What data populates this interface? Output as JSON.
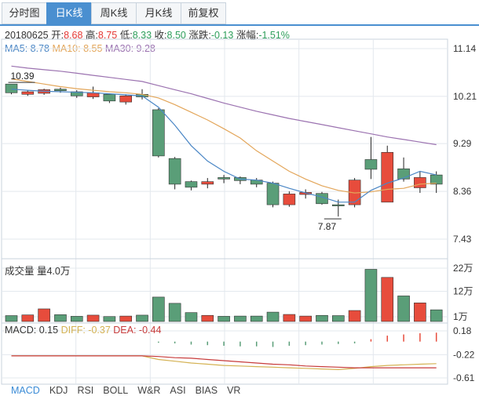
{
  "tabs": [
    {
      "label": "分时图",
      "active": false
    },
    {
      "label": "日K线",
      "active": true
    },
    {
      "label": "周K线",
      "active": false
    },
    {
      "label": "月K线",
      "active": false
    },
    {
      "label": "前复权",
      "active": false
    }
  ],
  "quote": {
    "date": "20180625",
    "open_label": "开:",
    "open": "8.68",
    "high_label": "高:",
    "high": "8.75",
    "low_label": "低:",
    "low": "8.33",
    "close_label": "收:",
    "close": "8.50",
    "change_label": "涨跌:",
    "change": "-0.13",
    "pct_label": "涨幅:",
    "pct": "-1.51%"
  },
  "ma_legend": {
    "ma5_label": "MA5: ",
    "ma5": "8.78",
    "ma10_label": "MA10: ",
    "ma10": "8.55",
    "ma30_label": "MA30: ",
    "ma30": "9.28"
  },
  "volume_legend": "成交量 量4.0万",
  "macd_legend": {
    "macd": "MACD: 0.15",
    "diff": "DIFF: -0.37",
    "dea": "DEA: -0.44"
  },
  "indicator_tabs": [
    {
      "label": "MACD",
      "active": true
    },
    {
      "label": "KDJ",
      "active": false
    },
    {
      "label": "RSI",
      "active": false
    },
    {
      "label": "BOLL",
      "active": false
    },
    {
      "label": "W&R",
      "active": false
    },
    {
      "label": "ASI",
      "active": false
    },
    {
      "label": "BIAS",
      "active": false
    },
    {
      "label": "VR",
      "active": false
    }
  ],
  "colors": {
    "up": "#e74c3c",
    "down": "#5a9e78",
    "ma5": "#4a86c5",
    "ma10": "#e3a65a",
    "ma30": "#9b72b0",
    "diff": "#d4b253",
    "dea": "#c73b3b",
    "grid": "#e3e8ee"
  },
  "chart_data": {
    "type": "candlestick",
    "price_axis": {
      "ticks": [
        "11.14",
        "10.21",
        "9.29",
        "8.36",
        "7.43"
      ],
      "ylim": [
        7.43,
        11.14
      ]
    },
    "volume_axis": {
      "ticks": [
        "22万",
        "12万",
        "1万"
      ],
      "ylim": [
        1,
        22
      ]
    },
    "macd_axis": {
      "ticks": [
        "0.18",
        "-0.22",
        "-0.61"
      ],
      "ylim": [
        -0.61,
        0.18
      ]
    },
    "annotations": [
      {
        "text": "10.39",
        "kind": "high"
      },
      {
        "text": "7.87",
        "kind": "low"
      }
    ],
    "candles": [
      {
        "open": 10.45,
        "close": 10.28,
        "high": 10.39,
        "low": 10.25,
        "volume": 1.5
      },
      {
        "open": 10.25,
        "close": 10.3,
        "high": 10.33,
        "low": 10.22,
        "volume": 1.8
      },
      {
        "open": 10.27,
        "close": 10.34,
        "high": 10.36,
        "low": 10.24,
        "volume": 4.4
      },
      {
        "open": 10.35,
        "close": 10.32,
        "high": 10.38,
        "low": 10.28,
        "volume": 1.9
      },
      {
        "open": 10.3,
        "close": 10.22,
        "high": 10.33,
        "low": 10.18,
        "volume": 1.2
      },
      {
        "open": 10.2,
        "close": 10.28,
        "high": 10.4,
        "low": 10.16,
        "volume": 1.7
      },
      {
        "open": 10.25,
        "close": 10.12,
        "high": 10.27,
        "low": 10.08,
        "volume": 1.1
      },
      {
        "open": 10.1,
        "close": 10.22,
        "high": 10.25,
        "low": 10.05,
        "volume": 1.3
      },
      {
        "open": 10.25,
        "close": 10.2,
        "high": 10.35,
        "low": 10.15,
        "volume": 1.7
      },
      {
        "open": 9.95,
        "close": 9.05,
        "high": 9.98,
        "low": 9.02,
        "volume": 9.5
      },
      {
        "open": 9.0,
        "close": 8.5,
        "high": 9.03,
        "low": 8.4,
        "volume": 6.8
      },
      {
        "open": 8.55,
        "close": 8.44,
        "high": 8.57,
        "low": 8.38,
        "volume": 2.8
      },
      {
        "open": 8.5,
        "close": 8.55,
        "high": 8.62,
        "low": 8.42,
        "volume": 1.6
      },
      {
        "open": 8.63,
        "close": 8.6,
        "high": 8.68,
        "low": 8.52,
        "volume": 1.2
      },
      {
        "open": 8.63,
        "close": 8.57,
        "high": 8.65,
        "low": 8.5,
        "volume": 1.3
      },
      {
        "open": 8.58,
        "close": 8.5,
        "high": 8.62,
        "low": 8.44,
        "volume": 1.3
      },
      {
        "open": 8.52,
        "close": 8.1,
        "high": 8.55,
        "low": 8.05,
        "volume": 3.0
      },
      {
        "open": 8.1,
        "close": 8.31,
        "high": 8.36,
        "low": 8.06,
        "volume": 2.0
      },
      {
        "open": 8.3,
        "close": 8.34,
        "high": 8.4,
        "low": 8.22,
        "volume": 1.3
      },
      {
        "open": 8.32,
        "close": 8.12,
        "high": 8.35,
        "low": 8.1,
        "volume": 1.6
      },
      {
        "open": 8.1,
        "close": 8.08,
        "high": 8.2,
        "low": 7.87,
        "volume": 1.5
      },
      {
        "open": 8.1,
        "close": 8.58,
        "high": 8.62,
        "low": 8.05,
        "volume": 3.7
      },
      {
        "open": 8.98,
        "close": 8.79,
        "high": 9.42,
        "low": 8.6,
        "volume": 21.5
      },
      {
        "open": 8.15,
        "close": 9.12,
        "high": 9.25,
        "low": 8.15,
        "volume": 18.0
      },
      {
        "open": 8.8,
        "close": 8.6,
        "high": 9.02,
        "low": 8.55,
        "volume": 10.0
      },
      {
        "open": 8.43,
        "close": 8.63,
        "high": 8.75,
        "low": 8.33,
        "volume": 7.0
      },
      {
        "open": 8.68,
        "close": 8.5,
        "high": 8.75,
        "low": 8.33,
        "volume": 4.0
      }
    ],
    "ma5": [
      10.35,
      10.33,
      10.31,
      10.3,
      10.29,
      10.28,
      10.26,
      10.24,
      10.22,
      10.0,
      9.65,
      9.25,
      8.95,
      8.75,
      8.6,
      8.58,
      8.52,
      8.42,
      8.33,
      8.25,
      8.15,
      8.15,
      8.38,
      8.52,
      8.62,
      8.75,
      8.68
    ],
    "ma10": [
      10.55,
      10.5,
      10.45,
      10.4,
      10.36,
      10.33,
      10.3,
      10.28,
      10.25,
      10.18,
      10.05,
      9.9,
      9.75,
      9.58,
      9.4,
      9.15,
      8.95,
      8.75,
      8.6,
      8.47,
      8.38,
      8.33,
      8.35,
      8.4,
      8.42,
      8.5,
      8.52
    ],
    "ma30": [
      10.8,
      10.76,
      10.73,
      10.7,
      10.66,
      10.62,
      10.58,
      10.54,
      10.5,
      10.42,
      10.34,
      10.26,
      10.17,
      10.08,
      10.0,
      9.92,
      9.85,
      9.78,
      9.72,
      9.66,
      9.6,
      9.54,
      9.48,
      9.42,
      9.37,
      9.32,
      9.27
    ],
    "macd": [
      0,
      0,
      0,
      0,
      0,
      0,
      0,
      0,
      0,
      -0.02,
      -0.03,
      -0.05,
      -0.06,
      -0.07,
      -0.08,
      -0.08,
      -0.09,
      -0.07,
      -0.06,
      -0.05,
      -0.04,
      -0.03,
      0.04,
      0.1,
      0.12,
      0.14,
      0.15
    ],
    "diff": [
      -0.24,
      -0.24,
      -0.24,
      -0.24,
      -0.24,
      -0.24,
      -0.24,
      -0.24,
      -0.24,
      -0.3,
      -0.33,
      -0.36,
      -0.38,
      -0.4,
      -0.41,
      -0.42,
      -0.43,
      -0.44,
      -0.45,
      -0.46,
      -0.47,
      -0.45,
      -0.42,
      -0.4,
      -0.39,
      -0.38,
      -0.37
    ],
    "dea": [
      -0.24,
      -0.24,
      -0.24,
      -0.24,
      -0.24,
      -0.24,
      -0.24,
      -0.24,
      -0.24,
      -0.25,
      -0.27,
      -0.28,
      -0.3,
      -0.32,
      -0.34,
      -0.36,
      -0.38,
      -0.39,
      -0.41,
      -0.42,
      -0.43,
      -0.44,
      -0.44,
      -0.44,
      -0.44,
      -0.44,
      -0.44
    ]
  }
}
